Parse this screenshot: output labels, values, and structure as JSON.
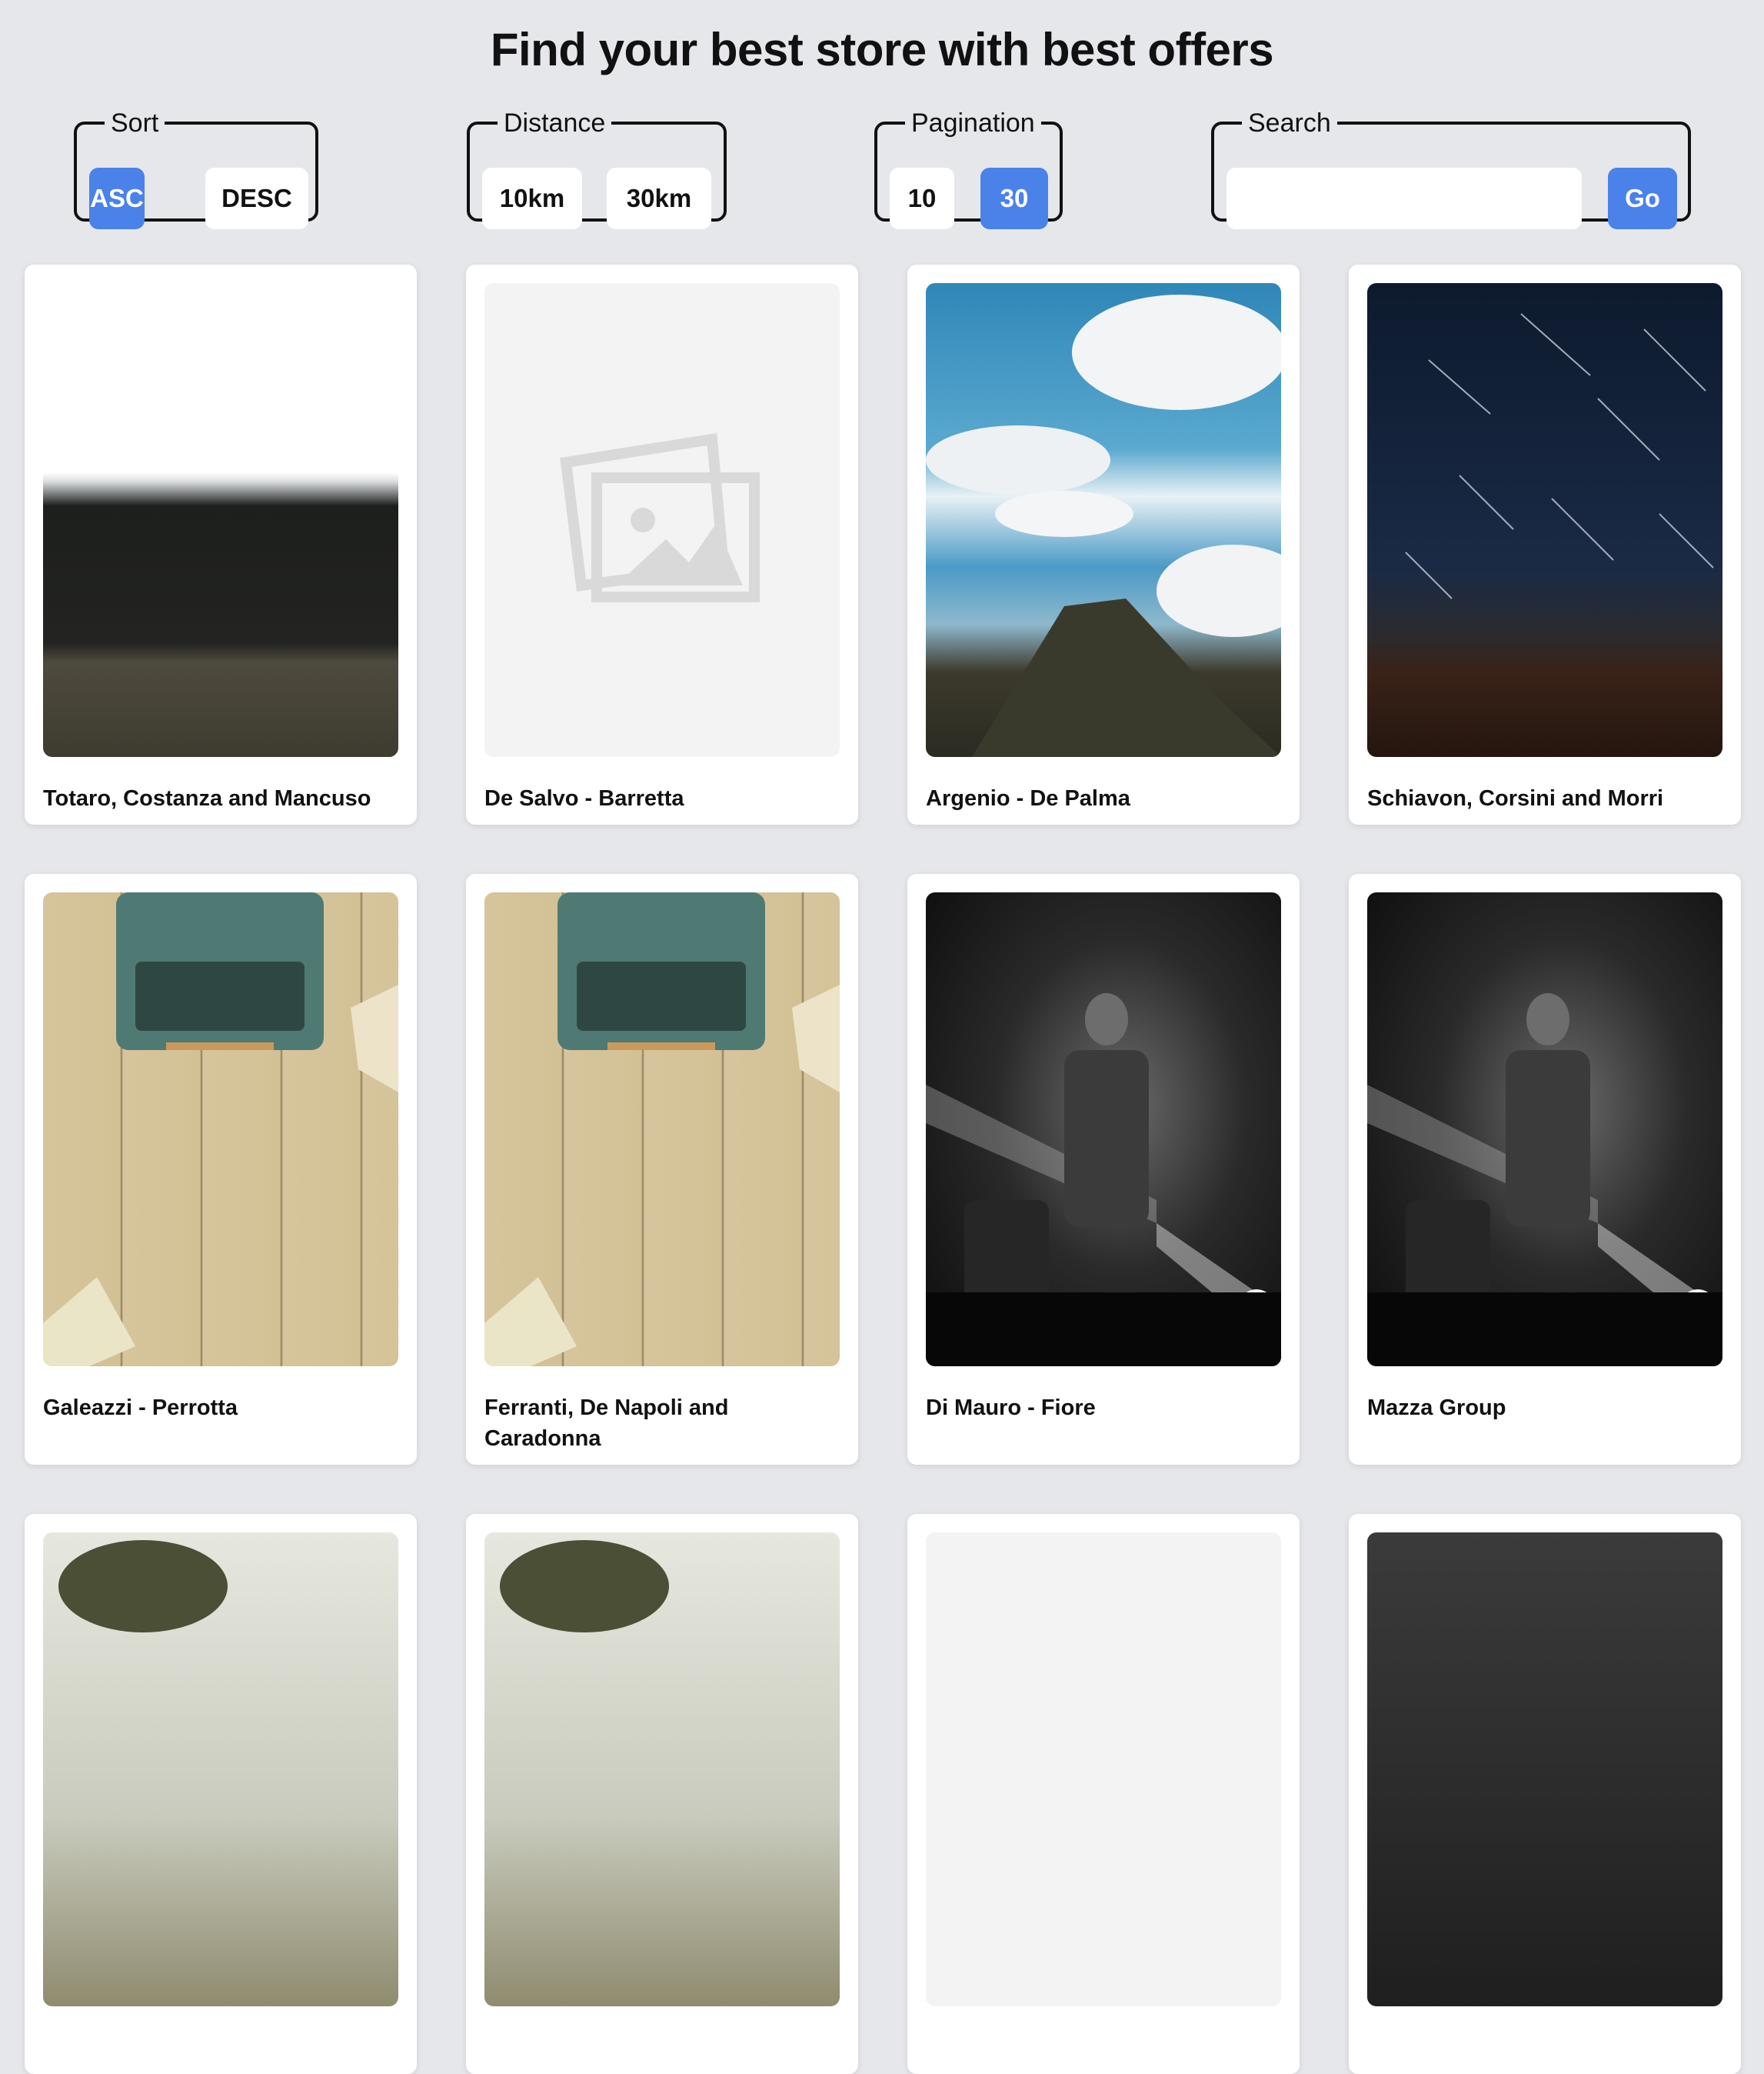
{
  "page": {
    "title": "Find your best store with best offers"
  },
  "filters": {
    "sort": {
      "legend": "Sort",
      "asc_label": "ASC",
      "desc_label": "DESC",
      "active": "ASC"
    },
    "distance": {
      "legend": "Distance",
      "option1": "10km",
      "option2": "30km"
    },
    "pagination": {
      "legend": "Pagination",
      "option1": "10",
      "option2": "30",
      "active": "30"
    },
    "search": {
      "legend": "Search",
      "value": "",
      "go_label": "Go"
    }
  },
  "colors": {
    "accent": "#4a82ea",
    "background": "#e6e7eb"
  },
  "stores": [
    {
      "name": "Totaro, Costanza and Mancuso",
      "image": "forest"
    },
    {
      "name": "De Salvo - Barretta",
      "image": "placeholder"
    },
    {
      "name": "Argenio - De Palma",
      "image": "mountain-sky"
    },
    {
      "name": "Schiavon, Corsini and Morri",
      "image": "star-trails"
    },
    {
      "name": "Galeazzi - Perrotta",
      "image": "typewriter"
    },
    {
      "name": "Ferranti, De Napoli and Caradonna",
      "image": "typewriter"
    },
    {
      "name": "Di Mauro - Fiore",
      "image": "concert"
    },
    {
      "name": "Mazza Group",
      "image": "concert"
    },
    {
      "name": "",
      "image": "tree"
    },
    {
      "name": "",
      "image": "tree"
    },
    {
      "name": "",
      "image": "blank"
    },
    {
      "name": "",
      "image": "dark-building"
    }
  ]
}
